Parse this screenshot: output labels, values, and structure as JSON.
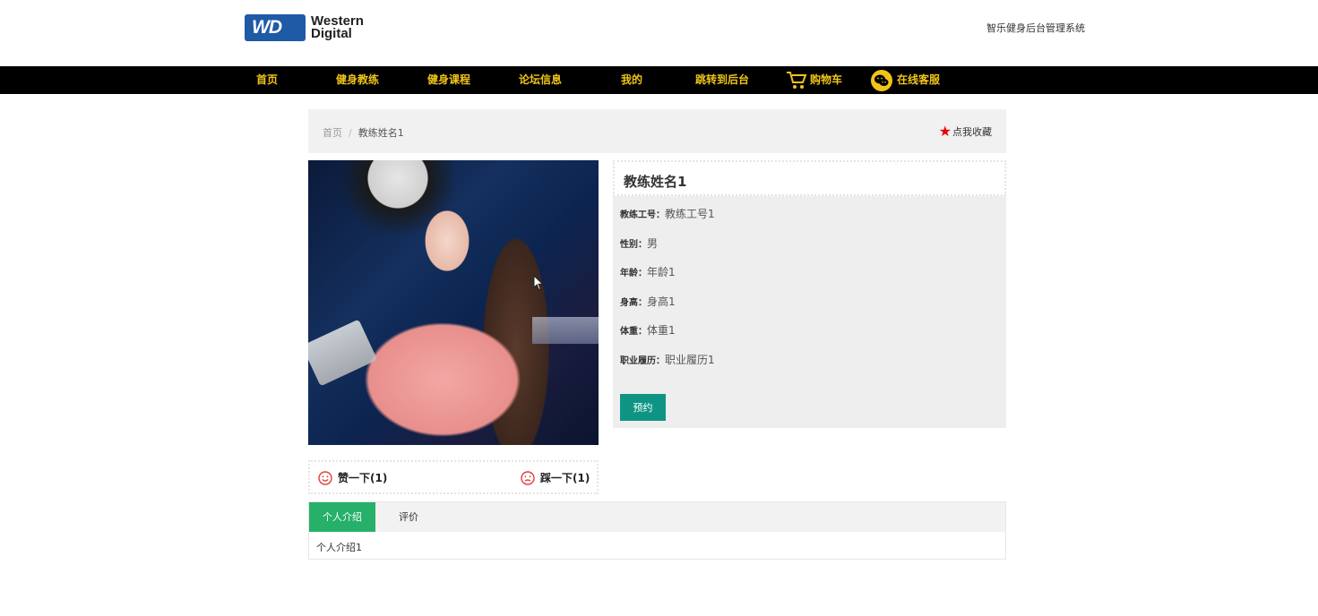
{
  "header": {
    "logo_line1": "Western",
    "logo_line2": "Digital",
    "logo_badge": "WD",
    "system_title": "智乐健身后台管理系统"
  },
  "nav": {
    "items": [
      {
        "label": "首页"
      },
      {
        "label": "健身教练"
      },
      {
        "label": "健身课程"
      },
      {
        "label": "论坛信息"
      },
      {
        "label": "我的"
      },
      {
        "label": "跳转到后台"
      },
      {
        "label": "购物车",
        "icon": "cart-icon"
      },
      {
        "label": "在线客服",
        "icon": "wechat-icon"
      }
    ],
    "text_color": "#f0c419",
    "background": "#000000"
  },
  "breadcrumb": {
    "home": "首页",
    "separator": "/",
    "current": "教练姓名1",
    "favorite_label": "点我收藏"
  },
  "coach": {
    "name": "教练姓名1",
    "fields": [
      {
        "key": "教练工号：",
        "value": "教练工号1"
      },
      {
        "key": "性别：",
        "value": "男"
      },
      {
        "key": "年龄：",
        "value": "年龄1"
      },
      {
        "key": "身高：",
        "value": "身高1"
      },
      {
        "key": "体重：",
        "value": "体重1"
      },
      {
        "key": "职业履历：",
        "value": "职业履历1"
      }
    ],
    "book_label": "预约"
  },
  "votes": {
    "like_label": "赞一下(1)",
    "dislike_label": "踩一下(1)"
  },
  "tabs": {
    "items": [
      {
        "label": "个人介绍",
        "active": true
      },
      {
        "label": "评价",
        "active": false
      }
    ],
    "content": "个人介绍1"
  },
  "colors": {
    "accent_green": "#27b06a",
    "button_teal": "#0f9484",
    "star_red": "#ee0000"
  }
}
